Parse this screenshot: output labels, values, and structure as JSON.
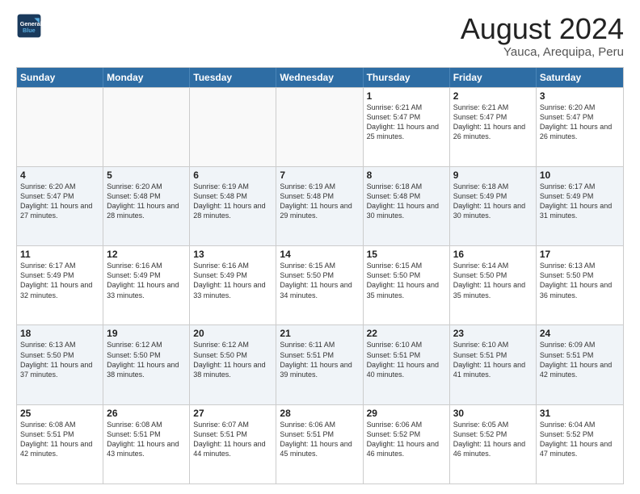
{
  "header": {
    "logo_line1": "General",
    "logo_line2": "Blue",
    "title": "August 2024",
    "subtitle": "Yauca, Arequipa, Peru"
  },
  "weekdays": [
    "Sunday",
    "Monday",
    "Tuesday",
    "Wednesday",
    "Thursday",
    "Friday",
    "Saturday"
  ],
  "weeks": [
    [
      {
        "day": "",
        "sunrise": "",
        "sunset": "",
        "daylight": "",
        "empty": true
      },
      {
        "day": "",
        "sunrise": "",
        "sunset": "",
        "daylight": "",
        "empty": true
      },
      {
        "day": "",
        "sunrise": "",
        "sunset": "",
        "daylight": "",
        "empty": true
      },
      {
        "day": "",
        "sunrise": "",
        "sunset": "",
        "daylight": "",
        "empty": true
      },
      {
        "day": "1",
        "sunrise": "Sunrise: 6:21 AM",
        "sunset": "Sunset: 5:47 PM",
        "daylight": "Daylight: 11 hours and 25 minutes."
      },
      {
        "day": "2",
        "sunrise": "Sunrise: 6:21 AM",
        "sunset": "Sunset: 5:47 PM",
        "daylight": "Daylight: 11 hours and 26 minutes."
      },
      {
        "day": "3",
        "sunrise": "Sunrise: 6:20 AM",
        "sunset": "Sunset: 5:47 PM",
        "daylight": "Daylight: 11 hours and 26 minutes."
      }
    ],
    [
      {
        "day": "4",
        "sunrise": "Sunrise: 6:20 AM",
        "sunset": "Sunset: 5:47 PM",
        "daylight": "Daylight: 11 hours and 27 minutes."
      },
      {
        "day": "5",
        "sunrise": "Sunrise: 6:20 AM",
        "sunset": "Sunset: 5:48 PM",
        "daylight": "Daylight: 11 hours and 28 minutes."
      },
      {
        "day": "6",
        "sunrise": "Sunrise: 6:19 AM",
        "sunset": "Sunset: 5:48 PM",
        "daylight": "Daylight: 11 hours and 28 minutes."
      },
      {
        "day": "7",
        "sunrise": "Sunrise: 6:19 AM",
        "sunset": "Sunset: 5:48 PM",
        "daylight": "Daylight: 11 hours and 29 minutes."
      },
      {
        "day": "8",
        "sunrise": "Sunrise: 6:18 AM",
        "sunset": "Sunset: 5:48 PM",
        "daylight": "Daylight: 11 hours and 30 minutes."
      },
      {
        "day": "9",
        "sunrise": "Sunrise: 6:18 AM",
        "sunset": "Sunset: 5:49 PM",
        "daylight": "Daylight: 11 hours and 30 minutes."
      },
      {
        "day": "10",
        "sunrise": "Sunrise: 6:17 AM",
        "sunset": "Sunset: 5:49 PM",
        "daylight": "Daylight: 11 hours and 31 minutes."
      }
    ],
    [
      {
        "day": "11",
        "sunrise": "Sunrise: 6:17 AM",
        "sunset": "Sunset: 5:49 PM",
        "daylight": "Daylight: 11 hours and 32 minutes."
      },
      {
        "day": "12",
        "sunrise": "Sunrise: 6:16 AM",
        "sunset": "Sunset: 5:49 PM",
        "daylight": "Daylight: 11 hours and 33 minutes."
      },
      {
        "day": "13",
        "sunrise": "Sunrise: 6:16 AM",
        "sunset": "Sunset: 5:49 PM",
        "daylight": "Daylight: 11 hours and 33 minutes."
      },
      {
        "day": "14",
        "sunrise": "Sunrise: 6:15 AM",
        "sunset": "Sunset: 5:50 PM",
        "daylight": "Daylight: 11 hours and 34 minutes."
      },
      {
        "day": "15",
        "sunrise": "Sunrise: 6:15 AM",
        "sunset": "Sunset: 5:50 PM",
        "daylight": "Daylight: 11 hours and 35 minutes."
      },
      {
        "day": "16",
        "sunrise": "Sunrise: 6:14 AM",
        "sunset": "Sunset: 5:50 PM",
        "daylight": "Daylight: 11 hours and 35 minutes."
      },
      {
        "day": "17",
        "sunrise": "Sunrise: 6:13 AM",
        "sunset": "Sunset: 5:50 PM",
        "daylight": "Daylight: 11 hours and 36 minutes."
      }
    ],
    [
      {
        "day": "18",
        "sunrise": "Sunrise: 6:13 AM",
        "sunset": "Sunset: 5:50 PM",
        "daylight": "Daylight: 11 hours and 37 minutes."
      },
      {
        "day": "19",
        "sunrise": "Sunrise: 6:12 AM",
        "sunset": "Sunset: 5:50 PM",
        "daylight": "Daylight: 11 hours and 38 minutes."
      },
      {
        "day": "20",
        "sunrise": "Sunrise: 6:12 AM",
        "sunset": "Sunset: 5:50 PM",
        "daylight": "Daylight: 11 hours and 38 minutes."
      },
      {
        "day": "21",
        "sunrise": "Sunrise: 6:11 AM",
        "sunset": "Sunset: 5:51 PM",
        "daylight": "Daylight: 11 hours and 39 minutes."
      },
      {
        "day": "22",
        "sunrise": "Sunrise: 6:10 AM",
        "sunset": "Sunset: 5:51 PM",
        "daylight": "Daylight: 11 hours and 40 minutes."
      },
      {
        "day": "23",
        "sunrise": "Sunrise: 6:10 AM",
        "sunset": "Sunset: 5:51 PM",
        "daylight": "Daylight: 11 hours and 41 minutes."
      },
      {
        "day": "24",
        "sunrise": "Sunrise: 6:09 AM",
        "sunset": "Sunset: 5:51 PM",
        "daylight": "Daylight: 11 hours and 42 minutes."
      }
    ],
    [
      {
        "day": "25",
        "sunrise": "Sunrise: 6:08 AM",
        "sunset": "Sunset: 5:51 PM",
        "daylight": "Daylight: 11 hours and 42 minutes."
      },
      {
        "day": "26",
        "sunrise": "Sunrise: 6:08 AM",
        "sunset": "Sunset: 5:51 PM",
        "daylight": "Daylight: 11 hours and 43 minutes."
      },
      {
        "day": "27",
        "sunrise": "Sunrise: 6:07 AM",
        "sunset": "Sunset: 5:51 PM",
        "daylight": "Daylight: 11 hours and 44 minutes."
      },
      {
        "day": "28",
        "sunrise": "Sunrise: 6:06 AM",
        "sunset": "Sunset: 5:51 PM",
        "daylight": "Daylight: 11 hours and 45 minutes."
      },
      {
        "day": "29",
        "sunrise": "Sunrise: 6:06 AM",
        "sunset": "Sunset: 5:52 PM",
        "daylight": "Daylight: 11 hours and 46 minutes."
      },
      {
        "day": "30",
        "sunrise": "Sunrise: 6:05 AM",
        "sunset": "Sunset: 5:52 PM",
        "daylight": "Daylight: 11 hours and 46 minutes."
      },
      {
        "day": "31",
        "sunrise": "Sunrise: 6:04 AM",
        "sunset": "Sunset: 5:52 PM",
        "daylight": "Daylight: 11 hours and 47 minutes."
      }
    ]
  ]
}
